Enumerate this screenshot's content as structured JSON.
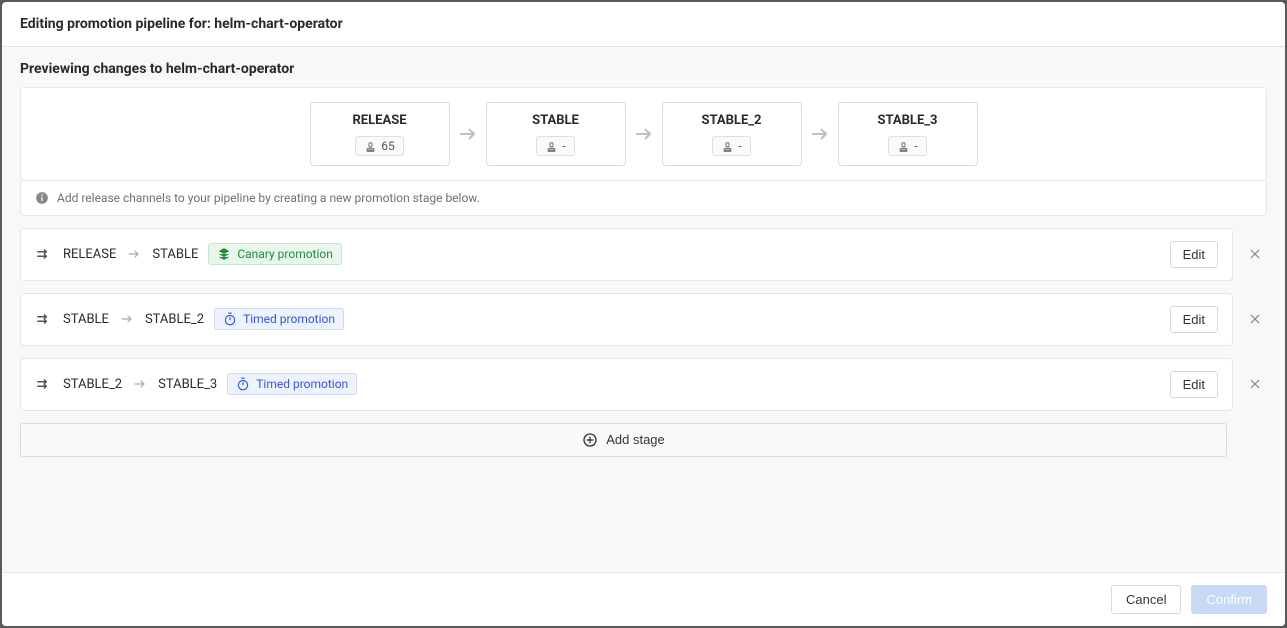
{
  "header": {
    "title_prefix": "Editing promotion pipeline for:",
    "title_name": "helm-chart-operator"
  },
  "preview": {
    "title_prefix": "Previewing changes to",
    "title_name": "helm-chart-operator",
    "channels": [
      {
        "name": "RELEASE",
        "count": "65"
      },
      {
        "name": "STABLE",
        "count": "-"
      },
      {
        "name": "STABLE_2",
        "count": "-"
      },
      {
        "name": "STABLE_3",
        "count": "-"
      }
    ]
  },
  "info_banner": "Add release channels to your pipeline by creating a new promotion stage below.",
  "stages": [
    {
      "from": "RELEASE",
      "to": "STABLE",
      "type": "canary",
      "badge": "Canary promotion",
      "edit": "Edit"
    },
    {
      "from": "STABLE",
      "to": "STABLE_2",
      "type": "timed",
      "badge": "Timed promotion",
      "edit": "Edit"
    },
    {
      "from": "STABLE_2",
      "to": "STABLE_3",
      "type": "timed",
      "badge": "Timed promotion",
      "edit": "Edit"
    }
  ],
  "add_stage_label": "Add stage",
  "footer": {
    "cancel": "Cancel",
    "confirm": "Confirm"
  }
}
